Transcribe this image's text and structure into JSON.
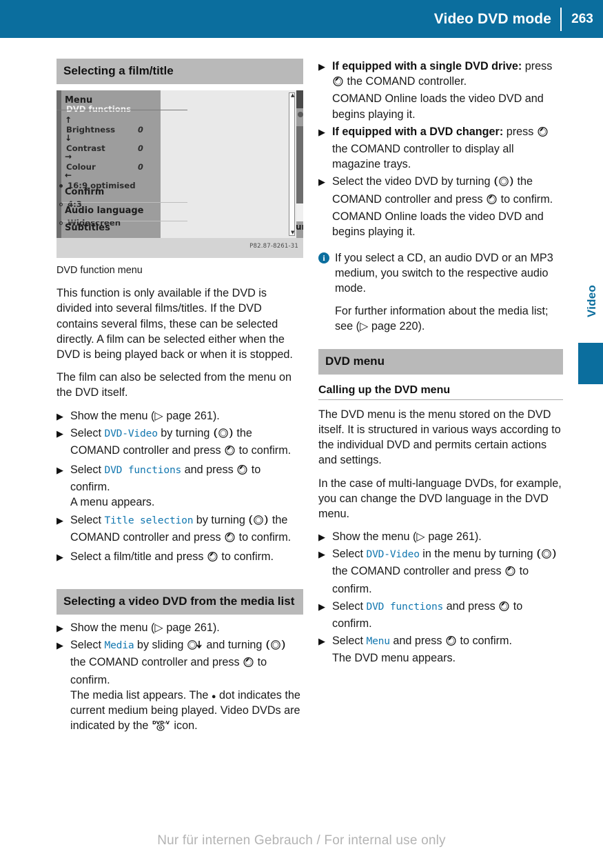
{
  "header": {
    "title": "Video DVD mode",
    "page_number": "263"
  },
  "side_tab": {
    "label": "Video"
  },
  "footer": {
    "watermark": "Nur für internen Gebrauch / For internal use only"
  },
  "glyphs": {
    "turn": "turn-controller-icon",
    "press": "press-controller-icon",
    "slide_down": "slide-down-controller-icon",
    "step_arrow": "▶",
    "page_ref_arrow": "▷",
    "info": "i",
    "dvd_v": "DVD-V"
  },
  "left_column": {
    "heading_1": "Selecting a film/title",
    "figure": {
      "caption": "DVD function menu",
      "left_panel": {
        "items": [
          {
            "label": "DVD functions",
            "value": "",
            "highlighted": true,
            "radio": "none"
          },
          {
            "label": "Brightness",
            "value": "0",
            "highlighted": false,
            "radio": "none"
          },
          {
            "label": "Contrast",
            "value": "0",
            "highlighted": false,
            "radio": "none"
          },
          {
            "label": "Colour",
            "value": "0",
            "highlighted": false,
            "radio": "none"
          },
          {
            "label": "16:9 optimised",
            "value": "",
            "highlighted": false,
            "radio": "on"
          },
          {
            "label": "4:3",
            "value": "",
            "highlighted": false,
            "radio": "off"
          },
          {
            "label": "Widescreen",
            "value": "",
            "highlighted": false,
            "radio": "off"
          }
        ]
      },
      "menu_panel": {
        "title": "Menu",
        "arrows": [
          "↑",
          "↓",
          "→",
          "←"
        ],
        "items": [
          "Confirm",
          "Audio language",
          "Subtitles"
        ]
      },
      "right_strip_label": "und",
      "image_code": "P82.87-8261-31"
    },
    "paragraphs": [
      "This function is only available if the DVD is divided into several films/titles. If the DVD contains several films, these can be selected directly. A film can be selected either when the DVD is being played back or when it is stopped.",
      "The film can also be selected from the menu on the DVD itself."
    ],
    "steps_1": [
      {
        "id": "show-menu",
        "parts": [
          {
            "t": "text",
            "v": "Show the menu ("
          },
          {
            "t": "pageref",
            "v": "▷ page 261"
          },
          {
            "t": "text",
            "v": ")."
          }
        ]
      },
      {
        "id": "select-dvd-video",
        "parts": [
          {
            "t": "text",
            "v": "Select "
          },
          {
            "t": "code",
            "v": "DVD-Video"
          },
          {
            "t": "text",
            "v": " by turning "
          },
          {
            "t": "glyph",
            "v": "turn"
          },
          {
            "t": "text",
            "v": " the COMAND controller and press "
          },
          {
            "t": "glyph",
            "v": "press"
          },
          {
            "t": "text",
            "v": " to confirm."
          }
        ]
      },
      {
        "id": "select-dvd-functions",
        "parts": [
          {
            "t": "text",
            "v": "Select "
          },
          {
            "t": "code",
            "v": "DVD functions"
          },
          {
            "t": "text",
            "v": " and press "
          },
          {
            "t": "glyph",
            "v": "press"
          },
          {
            "t": "text",
            "v": " to confirm."
          },
          {
            "t": "break"
          },
          {
            "t": "text",
            "v": "A menu appears."
          }
        ]
      },
      {
        "id": "select-title-selection",
        "parts": [
          {
            "t": "text",
            "v": "Select "
          },
          {
            "t": "code",
            "v": "Title selection"
          },
          {
            "t": "text",
            "v": " by turning "
          },
          {
            "t": "glyph",
            "v": "turn"
          },
          {
            "t": "text",
            "v": " the COMAND controller and press "
          },
          {
            "t": "glyph",
            "v": "press"
          },
          {
            "t": "text",
            "v": " to confirm."
          }
        ]
      },
      {
        "id": "select-film-title",
        "parts": [
          {
            "t": "text",
            "v": "Select a film/title and press "
          },
          {
            "t": "glyph",
            "v": "press"
          },
          {
            "t": "text",
            "v": " to confirm."
          }
        ]
      }
    ],
    "heading_2": "Selecting a video DVD from the media list",
    "steps_2": [
      {
        "id": "show-menu-2",
        "parts": [
          {
            "t": "text",
            "v": "Show the menu ("
          },
          {
            "t": "pageref",
            "v": "▷ page 261"
          },
          {
            "t": "text",
            "v": ")."
          }
        ]
      },
      {
        "id": "select-media",
        "parts": [
          {
            "t": "text",
            "v": "Select "
          },
          {
            "t": "code",
            "v": "Media"
          },
          {
            "t": "text",
            "v": " by sliding "
          },
          {
            "t": "glyph",
            "v": "slide_down"
          },
          {
            "t": "text",
            "v": " and turning "
          },
          {
            "t": "glyph",
            "v": "turn"
          },
          {
            "t": "text",
            "v": " the COMAND controller and press "
          },
          {
            "t": "glyph",
            "v": "press"
          },
          {
            "t": "text",
            "v": " to confirm."
          },
          {
            "t": "break"
          },
          {
            "t": "text",
            "v": "The media list appears. The "
          },
          {
            "t": "bulletdot",
            "v": "●"
          },
          {
            "t": "text",
            "v": " dot indicates the current medium being played. Video DVDs are indicated by the "
          },
          {
            "t": "glyph",
            "v": "dvdv"
          },
          {
            "t": "text",
            "v": " icon."
          }
        ]
      }
    ]
  },
  "right_column": {
    "steps_top": [
      {
        "id": "single-dvd-drive",
        "parts": [
          {
            "t": "bold",
            "v": "If equipped with a single DVD drive:"
          },
          {
            "t": "text",
            "v": " press "
          },
          {
            "t": "glyph",
            "v": "press"
          },
          {
            "t": "text",
            "v": " the COMAND controller."
          },
          {
            "t": "break"
          },
          {
            "t": "text",
            "v": "COMAND Online loads the video DVD and begins playing it."
          }
        ]
      },
      {
        "id": "dvd-changer",
        "parts": [
          {
            "t": "bold",
            "v": "If equipped with a DVD changer:"
          },
          {
            "t": "text",
            "v": " press "
          },
          {
            "t": "glyph",
            "v": "press"
          },
          {
            "t": "text",
            "v": " the COMAND controller to display all magazine trays."
          }
        ]
      },
      {
        "id": "select-video-dvd",
        "parts": [
          {
            "t": "text",
            "v": "Select the video DVD by turning "
          },
          {
            "t": "glyph",
            "v": "turn"
          },
          {
            "t": "text",
            "v": " the COMAND controller and press "
          },
          {
            "t": "glyph",
            "v": "press"
          },
          {
            "t": "text",
            "v": " to confirm."
          },
          {
            "t": "break"
          },
          {
            "t": "text",
            "v": "COMAND Online loads the video DVD and begins playing it."
          }
        ]
      }
    ],
    "note": {
      "paragraphs": [
        "If you select a CD, an audio DVD or an MP3 medium, you switch to the respective audio mode.",
        "For further information about the media list; see (▷ page 220)."
      ]
    },
    "heading": "DVD menu",
    "sub_heading": "Calling up the DVD menu",
    "paragraphs": [
      "The DVD menu is the menu stored on the DVD itself. It is structured in various ways according to the individual DVD and permits certain actions and settings.",
      "In the case of multi-language DVDs, for example, you can change the DVD language in the DVD menu."
    ],
    "steps_bottom": [
      {
        "id": "show-menu-3",
        "parts": [
          {
            "t": "text",
            "v": "Show the menu ("
          },
          {
            "t": "pageref",
            "v": "▷ page 261"
          },
          {
            "t": "text",
            "v": ")."
          }
        ]
      },
      {
        "id": "select-dvd-video-2",
        "parts": [
          {
            "t": "text",
            "v": "Select "
          },
          {
            "t": "code",
            "v": "DVD-Video"
          },
          {
            "t": "text",
            "v": " in the menu by turning "
          },
          {
            "t": "glyph",
            "v": "turn"
          },
          {
            "t": "text",
            "v": " the COMAND controller and press "
          },
          {
            "t": "glyph",
            "v": "press"
          },
          {
            "t": "text",
            "v": " to confirm."
          }
        ]
      },
      {
        "id": "select-dvd-functions-2",
        "parts": [
          {
            "t": "text",
            "v": "Select "
          },
          {
            "t": "code",
            "v": "DVD functions"
          },
          {
            "t": "text",
            "v": " and press "
          },
          {
            "t": "glyph",
            "v": "press"
          },
          {
            "t": "text",
            "v": " to confirm."
          }
        ]
      },
      {
        "id": "select-menu",
        "parts": [
          {
            "t": "text",
            "v": "Select "
          },
          {
            "t": "code",
            "v": "Menu"
          },
          {
            "t": "text",
            "v": " and press "
          },
          {
            "t": "glyph",
            "v": "press"
          },
          {
            "t": "text",
            "v": " to confirm."
          },
          {
            "t": "break"
          },
          {
            "t": "text",
            "v": "The DVD menu appears."
          }
        ]
      }
    ]
  },
  "colors": {
    "brand_blue": "#0b6e9e",
    "code_blue": "#1277b0",
    "heading_band": "#b9b9b9"
  }
}
